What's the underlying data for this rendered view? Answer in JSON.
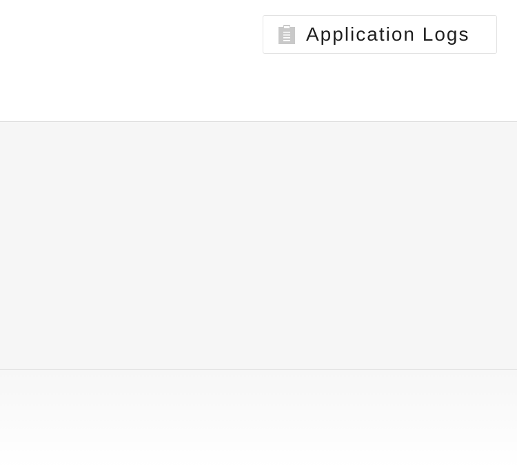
{
  "header": {
    "logs_button": {
      "label": "Application Logs",
      "icon": "clipboard-icon"
    }
  },
  "colors": {
    "header_bg": "#ffffff",
    "content_bg": "#f6f6f6",
    "divider": "#dcdcdc",
    "icon": "#c9c9c9",
    "text": "#1f1f1f"
  }
}
